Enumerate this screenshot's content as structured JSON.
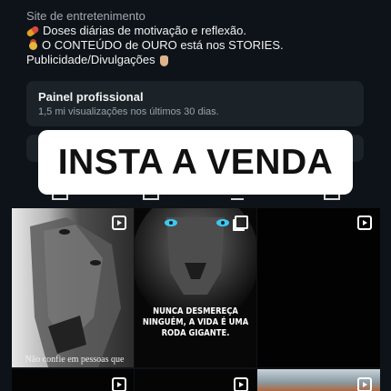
{
  "bio": {
    "category": "Site de entretenimento",
    "line1": "Doses diárias de motivação e reflexão.",
    "line2": "O CONTEÚDO de OURO está nos STORIES.",
    "line3": "Publicidade/Divulgações",
    "icon1": "pill-emoji",
    "icon2": "medal-emoji",
    "icon3": "pointing-down-emoji"
  },
  "professional_panel": {
    "title": "Painel profissional",
    "subtitle": "1,5 mi visualizações nos últimos 30 dias."
  },
  "overlay_banner": {
    "text": "INSTA A VENDA"
  },
  "posts": [
    {
      "kind": "reel",
      "image": "wolf",
      "caption": "Não confie em pessoas que pensam que dinheiro é tudo, pois"
    },
    {
      "kind": "carousel",
      "image": "lion",
      "caption": "NUNCA DESMEREÇA NINGUÉM, A VIDA É UMA RODA GIGANTE."
    },
    {
      "kind": "reel",
      "image": "dark",
      "caption": ""
    },
    {
      "kind": "reel",
      "image": "dark",
      "caption": ""
    },
    {
      "kind": "reel",
      "image": "dark",
      "caption": ""
    },
    {
      "kind": "reel",
      "image": "beach",
      "caption": ""
    }
  ],
  "colors": {
    "background": "#0d1318",
    "panel": "#1c2328",
    "banner": "#ffffff",
    "lion_eyes": "#3ec8f0"
  }
}
